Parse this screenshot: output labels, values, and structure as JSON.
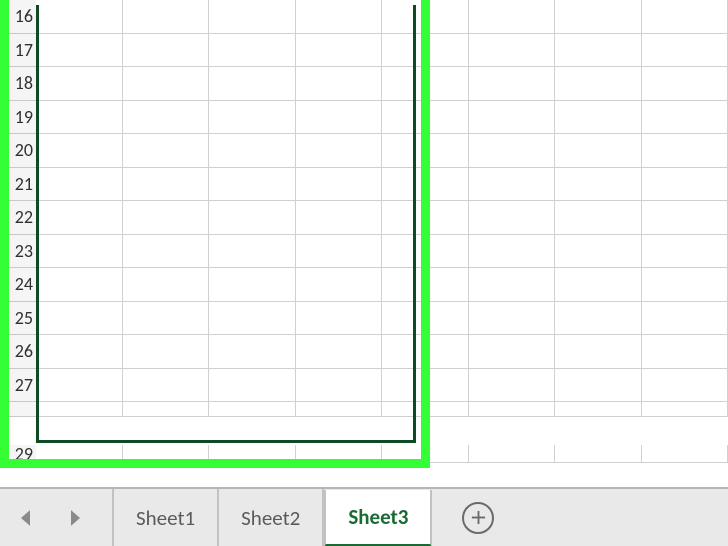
{
  "rows": [
    "16",
    "17",
    "18",
    "19",
    "20",
    "21",
    "22",
    "23",
    "24",
    "25",
    "26",
    "27"
  ],
  "next_row": "29",
  "tabs": {
    "sheet1": "Sheet1",
    "sheet2": "Sheet2",
    "sheet3": "Sheet3"
  },
  "icons": {
    "nav_prev": "nav-prev-icon",
    "nav_next": "nav-next-icon",
    "add": "plus-icon"
  }
}
